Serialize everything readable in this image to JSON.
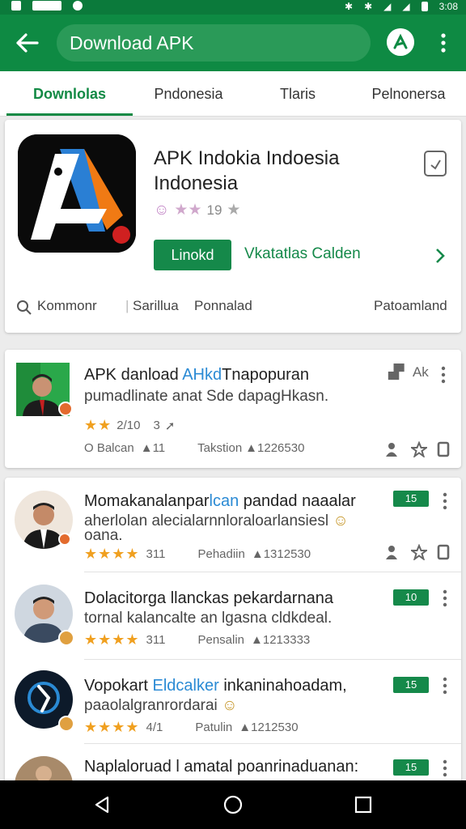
{
  "status_bar": {
    "time": "3:08"
  },
  "app_bar": {
    "search_text": "Download APK"
  },
  "tabs": [
    {
      "label": "Downlolas",
      "active": true
    },
    {
      "label": "Pndonesia",
      "active": false
    },
    {
      "label": "Tlaris",
      "active": false
    },
    {
      "label": "Pelnonersa",
      "active": false
    }
  ],
  "app": {
    "title": "APK Indokia Indoesia Indonesia",
    "rating_value": "19",
    "install_label": "Linokd",
    "wishlist_label": "Vkatatlas Calden",
    "links": [
      "Kommonr",
      "Sarillua",
      "Ponnalad",
      "Patoamland"
    ]
  },
  "featured_review": {
    "title_prefix": "APK danload ",
    "title_highlight": "AHkd",
    "title_suffix": "Tnapopuran",
    "body": "pumadlinate anat Sde dapagHkasn.",
    "rating_text": "2/10",
    "rating_extra": "3",
    "meta_left": "O Balcan",
    "meta_left_count": "11",
    "meta_right": "Takstion",
    "meta_right_count": "1226530",
    "header_badge": "Ak"
  },
  "reviews": [
    {
      "title_prefix": "Momakanalanpar",
      "title_highlight": "lcan",
      "title_suffix": " pandad naaalar",
      "body_line1": "aherlolan alecialarnnloraloarlansiesl",
      "body_line2": "oana.",
      "rating": "311",
      "meta_label": "Pehadiin",
      "meta_count": "1312530",
      "score": "15"
    },
    {
      "title_prefix": "Dolacitorga llanckas pekardarnana",
      "title_highlight": "",
      "title_suffix": "",
      "body_line1": "tornal kalancalte an lgasna cldkdeal.",
      "body_line2": "",
      "rating": "311",
      "meta_label": "Pensalin",
      "meta_count": "1213333",
      "score": "10"
    },
    {
      "title_prefix": "Vopokart ",
      "title_highlight": "Eldcalker",
      "title_suffix": " inkaninahoadam,",
      "body_line1": "paaolalgranrordarai",
      "body_line2": "",
      "rating": "4/1",
      "meta_label": "Patulin",
      "meta_count": "1212530",
      "score": "15"
    },
    {
      "title_prefix": "Naplaloruad l amatal",
      "title_highlight": "",
      "title_suffix": " poanrinaduanan:",
      "body_line1": "",
      "body_line2": "",
      "rating": "",
      "meta_label": "",
      "meta_count": "",
      "score": "15"
    }
  ]
}
